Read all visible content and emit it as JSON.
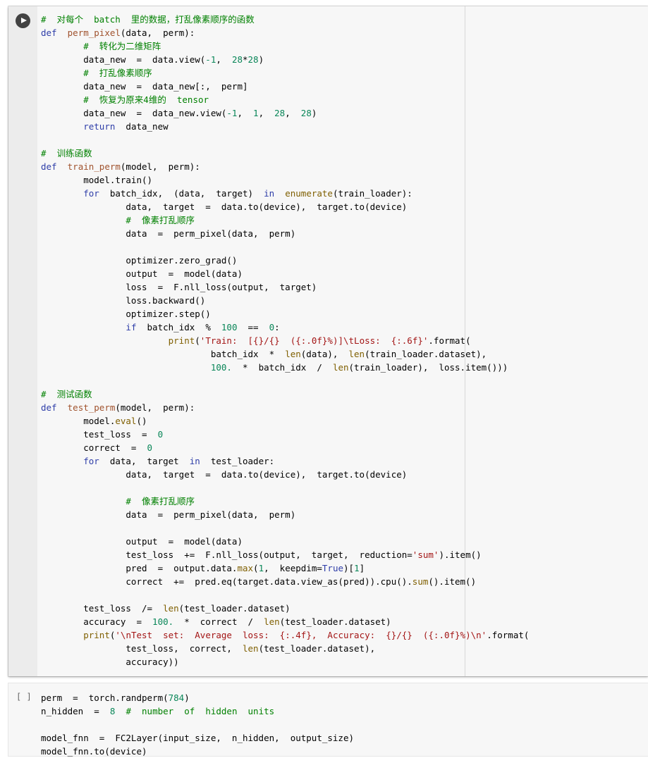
{
  "cells": [
    {
      "run_button_icon": "play-circle-icon",
      "lines": [
        [
          {
            "t": "#  对每个  batch  里的数据，打乱像素顺序的函数",
            "c": "cm"
          }
        ],
        [
          {
            "t": "def",
            "c": "kw"
          },
          {
            "t": "  "
          },
          {
            "t": "perm_pixel",
            "c": "fn"
          },
          {
            "t": "(data,  perm):"
          }
        ],
        [
          {
            "t": "        "
          },
          {
            "t": "#  转化为二维矩阵",
            "c": "cm"
          }
        ],
        [
          {
            "t": "        data_new  =  data.view("
          },
          {
            "t": "-1",
            "c": "num"
          },
          {
            "t": ",  "
          },
          {
            "t": "28",
            "c": "num"
          },
          {
            "t": "*"
          },
          {
            "t": "28",
            "c": "num"
          },
          {
            "t": ")"
          }
        ],
        [
          {
            "t": "        "
          },
          {
            "t": "#  打乱像素顺序",
            "c": "cm"
          }
        ],
        [
          {
            "t": "        data_new  =  data_new[:,  perm]"
          }
        ],
        [
          {
            "t": "        "
          },
          {
            "t": "#  恢复为原来4维的  tensor",
            "c": "cm"
          }
        ],
        [
          {
            "t": "        data_new  =  data_new.view("
          },
          {
            "t": "-1",
            "c": "num"
          },
          {
            "t": ",  "
          },
          {
            "t": "1",
            "c": "num"
          },
          {
            "t": ",  "
          },
          {
            "t": "28",
            "c": "num"
          },
          {
            "t": ",  "
          },
          {
            "t": "28",
            "c": "num"
          },
          {
            "t": ")"
          }
        ],
        [
          {
            "t": "        "
          },
          {
            "t": "return",
            "c": "kw"
          },
          {
            "t": "  data_new"
          }
        ],
        [],
        [
          {
            "t": "#  训练函数",
            "c": "cm"
          }
        ],
        [
          {
            "t": "def",
            "c": "kw"
          },
          {
            "t": "  "
          },
          {
            "t": "train_perm",
            "c": "fn"
          },
          {
            "t": "(model,  perm):"
          }
        ],
        [
          {
            "t": "        model.train()"
          }
        ],
        [
          {
            "t": "        "
          },
          {
            "t": "for",
            "c": "kw"
          },
          {
            "t": "  batch_idx,  (data,  target)  "
          },
          {
            "t": "in",
            "c": "kw"
          },
          {
            "t": "  "
          },
          {
            "t": "enumerate",
            "c": "bi"
          },
          {
            "t": "(train_loader):"
          }
        ],
        [
          {
            "t": "                data,  target  =  data.to(device),  target.to(device)"
          }
        ],
        [
          {
            "t": "                "
          },
          {
            "t": "#  像素打乱顺序",
            "c": "cm"
          }
        ],
        [
          {
            "t": "                data  =  perm_pixel(data,  perm)"
          }
        ],
        [],
        [
          {
            "t": "                optimizer.zero_grad()"
          }
        ],
        [
          {
            "t": "                output  =  model(data)"
          }
        ],
        [
          {
            "t": "                loss  =  F.nll_loss(output,  target)"
          }
        ],
        [
          {
            "t": "                loss.backward()"
          }
        ],
        [
          {
            "t": "                optimizer.step()"
          }
        ],
        [
          {
            "t": "                "
          },
          {
            "t": "if",
            "c": "kw"
          },
          {
            "t": "  batch_idx  %  "
          },
          {
            "t": "100",
            "c": "num"
          },
          {
            "t": "  ==  "
          },
          {
            "t": "0",
            "c": "num"
          },
          {
            "t": ":"
          }
        ],
        [
          {
            "t": "                        "
          },
          {
            "t": "print",
            "c": "bi"
          },
          {
            "t": "("
          },
          {
            "t": "'Train:  [{}/{}  ({:.0f}%)]\\tLoss:  {:.6f}'",
            "c": "str"
          },
          {
            "t": ".format("
          }
        ],
        [
          {
            "t": "                                batch_idx  *  "
          },
          {
            "t": "len",
            "c": "bi"
          },
          {
            "t": "(data),  "
          },
          {
            "t": "len",
            "c": "bi"
          },
          {
            "t": "(train_loader.dataset),"
          }
        ],
        [
          {
            "t": "                                "
          },
          {
            "t": "100.",
            "c": "num"
          },
          {
            "t": "  *  batch_idx  /  "
          },
          {
            "t": "len",
            "c": "bi"
          },
          {
            "t": "(train_loader),  loss.item()))"
          }
        ],
        [],
        [
          {
            "t": "#  测试函数",
            "c": "cm"
          }
        ],
        [
          {
            "t": "def",
            "c": "kw"
          },
          {
            "t": "  "
          },
          {
            "t": "test_perm",
            "c": "fn"
          },
          {
            "t": "(model,  perm):"
          }
        ],
        [
          {
            "t": "        model."
          },
          {
            "t": "eval",
            "c": "bi"
          },
          {
            "t": "()"
          }
        ],
        [
          {
            "t": "        test_loss  =  "
          },
          {
            "t": "0",
            "c": "num"
          }
        ],
        [
          {
            "t": "        correct  =  "
          },
          {
            "t": "0",
            "c": "num"
          }
        ],
        [
          {
            "t": "        "
          },
          {
            "t": "for",
            "c": "kw"
          },
          {
            "t": "  data,  target  "
          },
          {
            "t": "in",
            "c": "kw"
          },
          {
            "t": "  test_loader:"
          }
        ],
        [
          {
            "t": "                data,  target  =  data.to(device),  target.to(device)"
          }
        ],
        [],
        [
          {
            "t": "                "
          },
          {
            "t": "#  像素打乱顺序",
            "c": "cm"
          }
        ],
        [
          {
            "t": "                data  =  perm_pixel(data,  perm)"
          }
        ],
        [],
        [
          {
            "t": "                output  =  model(data)"
          }
        ],
        [
          {
            "t": "                test_loss  +=  F.nll_loss(output,  target,  reduction="
          },
          {
            "t": "'sum'",
            "c": "str"
          },
          {
            "t": ").item()"
          }
        ],
        [
          {
            "t": "                pred  =  output.data."
          },
          {
            "t": "max",
            "c": "bi"
          },
          {
            "t": "("
          },
          {
            "t": "1",
            "c": "num"
          },
          {
            "t": ",  keepdim="
          },
          {
            "t": "True",
            "c": "kw"
          },
          {
            "t": ")["
          },
          {
            "t": "1",
            "c": "num"
          },
          {
            "t": "]"
          }
        ],
        [
          {
            "t": "                correct  +=  pred.eq(target.data.view_as(pred)).cpu()."
          },
          {
            "t": "sum",
            "c": "bi"
          },
          {
            "t": "().item()"
          }
        ],
        [],
        [
          {
            "t": "        test_loss  /=  "
          },
          {
            "t": "len",
            "c": "bi"
          },
          {
            "t": "(test_loader.dataset)"
          }
        ],
        [
          {
            "t": "        accuracy  =  "
          },
          {
            "t": "100.",
            "c": "num"
          },
          {
            "t": "  *  correct  /  "
          },
          {
            "t": "len",
            "c": "bi"
          },
          {
            "t": "(test_loader.dataset)"
          }
        ],
        [
          {
            "t": "        "
          },
          {
            "t": "print",
            "c": "bi"
          },
          {
            "t": "("
          },
          {
            "t": "'\\nTest  set:  Average  loss:  {:.4f},  Accuracy:  {}/{}  ({:.0f}%)\\n'",
            "c": "str"
          },
          {
            "t": ".format("
          }
        ],
        [
          {
            "t": "                test_loss,  correct,  "
          },
          {
            "t": "len",
            "c": "bi"
          },
          {
            "t": "(test_loader.dataset),"
          }
        ],
        [
          {
            "t": "                accuracy))"
          }
        ]
      ]
    },
    {
      "exec_count": "[ ]",
      "lines": [
        [
          {
            "t": "perm  =  torch.randperm("
          },
          {
            "t": "784",
            "c": "num"
          },
          {
            "t": ")"
          }
        ],
        [
          {
            "t": "n_hidden  =  "
          },
          {
            "t": "8",
            "c": "num"
          },
          {
            "t": "  "
          },
          {
            "t": "#  number  of  hidden  units",
            "c": "cm"
          }
        ],
        [],
        [
          {
            "t": "model_fnn  =  FC2Layer(input_size,  n_hidden,  output_size)"
          }
        ],
        [
          {
            "t": "model_fnn.to(device)"
          }
        ]
      ]
    }
  ]
}
